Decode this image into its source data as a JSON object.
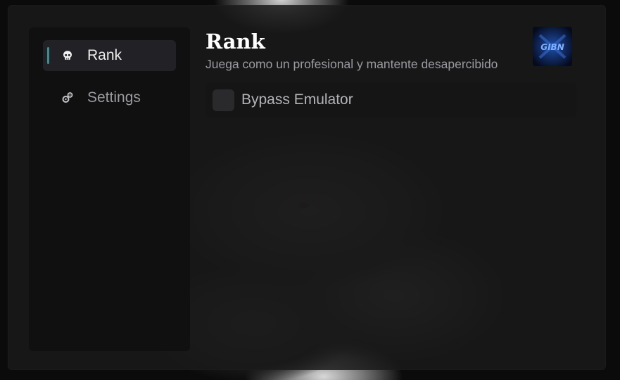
{
  "sidebar": {
    "items": [
      {
        "label": "Rank",
        "icon": "skull-icon",
        "active": true
      },
      {
        "label": "Settings",
        "icon": "gears-icon",
        "active": false
      }
    ]
  },
  "header": {
    "title": "Rank",
    "subtitle": "Juega como un profesional y mantente desapercibido",
    "avatar_icon": "user-avatar-logo",
    "avatar_text": "GIBN"
  },
  "options": [
    {
      "label": "Bypass Emulator",
      "checked": false
    }
  ],
  "colors": {
    "accent": "#3c8c92",
    "window_bg": "#1a1a1a",
    "sidebar_bg": "#0e0e0e",
    "active_item_bg": "#222226",
    "title": "#ffffff",
    "subtitle": "#9a9aa2"
  }
}
